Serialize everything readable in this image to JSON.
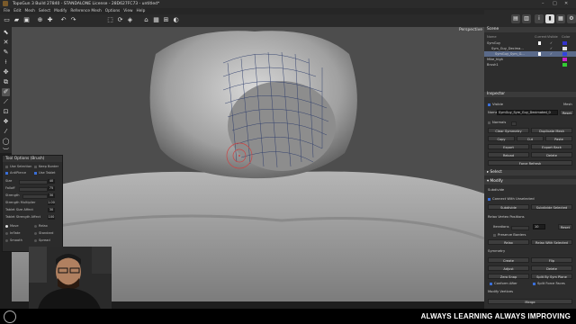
{
  "titlebar": {
    "title": "TopoGun 3 Build 27840 - STANDALONE License - 28D627FC73 - untitled*"
  },
  "menubar": [
    "File",
    "Edit",
    "Mesh",
    "Select",
    "Modify",
    "Reference Mesh",
    "Options",
    "View",
    "Help"
  ],
  "viewport": {
    "projection_label": "Perspective"
  },
  "tool_options": {
    "title": "Tool Options (Brush)",
    "use_selection": "Use Selection",
    "keep_border": "Keep Border",
    "anti_pierce": "AntiPierce",
    "use_tablet": "Use Tablet",
    "size_label": "Size",
    "size_value": "40",
    "falloff_label": "Falloff",
    "falloff_value": "75",
    "strength_label": "Strength",
    "strength_value": "30",
    "strength_multiplier_label": "Strength Multiplier",
    "strength_multiplier_value": "1.00",
    "tablet_size_affect_label": "Tablet Size Affect",
    "tablet_size_affect_value": "30",
    "tablet_strength_affect_label": "Tablet Strength Affect",
    "tablet_strength_affect_value": "100",
    "move": "Move",
    "relax": "Relax",
    "inflate": "Inflate",
    "standard": "Standard",
    "smooth": "Smooth",
    "spread": "Spread"
  },
  "scene": {
    "title": "Scene",
    "col_name": "Name",
    "col_current": "Current",
    "col_visible": "Visible",
    "col_color": "Color",
    "items": [
      {
        "name": "SymGuy",
        "color": "#3333cc"
      },
      {
        "name": "Sym_Guy_Decima...",
        "color": "#dddddd"
      },
      {
        "name": "SymGuy_Sym_G...",
        "color": "#3344dd"
      },
      {
        "name": "Mike_high",
        "color": "#cc22cc"
      },
      {
        "name": "Brush1",
        "color": "#33cc33"
      }
    ]
  },
  "inspector": {
    "title": "Inspector",
    "visible": "Visible",
    "mesh_label": "Mesh",
    "name_label": "Name",
    "name_value": "SymGuy_Sym_Guy_Decimated_0",
    "reset": "Reset",
    "normals": "Normals",
    "clear_symmetry": "Clear Symmetry",
    "duplicate_mesh": "Duplicate Mesh",
    "copy": "Copy",
    "cut": "Cut",
    "paste": "Paste",
    "export": "Export",
    "export_back": "Export Back",
    "reload": "Reload",
    "delete": "Delete",
    "force_refresh": "Force Refresh",
    "select_section": "Select",
    "modify_section": "Modify",
    "subdivide_label": "Subdivide",
    "connect_with_unselected": "Connect With Unselected",
    "subdivide_btn": "Subdivide",
    "subdivide_selected": "Subdivide Selected",
    "relax_positions": "Relax Vertex Positions",
    "iterations": "Iterations",
    "iterations_value": "10",
    "reset2": "Reset",
    "preserve_borders": "Preserve Borders",
    "relax_btn": "Relax",
    "relax_with_selected": "Relax With Selected",
    "symmetry": "Symmetry",
    "create": "Create",
    "flip": "Flip",
    "adjust": "Adjust",
    "delete2": "Delete",
    "zero_snap": "Zero Snap",
    "split_by_sym_plane": "Split By Sym Plane",
    "conform_after": "Conform After",
    "split_force_faces": "Split Force Faces",
    "modify_vertices": "Modify Vertices",
    "merge": "Merge"
  },
  "banner": {
    "text": "ALWAYS LEARNING ALWAYS IMPROVING"
  },
  "colors": {
    "accent": "#3a6fd8",
    "viewport_bg": "#4a4a4a"
  }
}
